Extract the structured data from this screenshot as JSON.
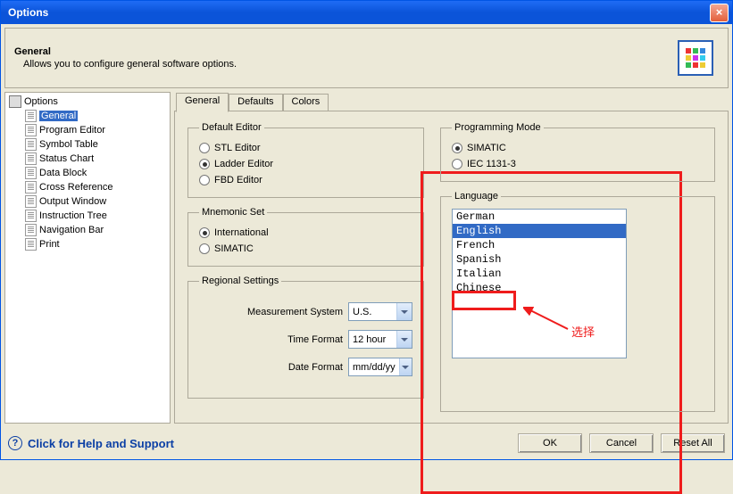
{
  "window": {
    "title": "Options"
  },
  "header": {
    "title": "General",
    "desc": "Allows you to configure general software options."
  },
  "tree": {
    "root": "Options",
    "items": [
      "General",
      "Program Editor",
      "Symbol Table",
      "Status Chart",
      "Data Block",
      "Cross Reference",
      "Output Window",
      "Instruction Tree",
      "Navigation Bar",
      "Print"
    ],
    "selected": 0
  },
  "tabs": {
    "items": [
      "General",
      "Defaults",
      "Colors"
    ],
    "active": 0
  },
  "default_editor": {
    "legend": "Default Editor",
    "options": [
      "STL Editor",
      "Ladder Editor",
      "FBD Editor"
    ],
    "selected": 1
  },
  "mnemonic_set": {
    "legend": "Mnemonic Set",
    "options": [
      "International",
      "SIMATIC"
    ],
    "selected": 0
  },
  "regional": {
    "legend": "Regional Settings",
    "measurement_label": "Measurement System",
    "measurement_value": "U.S.",
    "time_label": "Time Format",
    "time_value": "12 hour",
    "date_label": "Date Format",
    "date_value": "mm/dd/yy"
  },
  "programming_mode": {
    "legend": "Programming Mode",
    "options": [
      "SIMATIC",
      "IEC 1131-3"
    ],
    "selected": 0
  },
  "language": {
    "legend": "Language",
    "items": [
      "German",
      "English",
      "French",
      "Spanish",
      "Italian",
      "Chinese"
    ],
    "selected": 1
  },
  "annotation": {
    "text": "选择"
  },
  "footer": {
    "help": "Click for Help and Support",
    "ok": "OK",
    "cancel": "Cancel",
    "reset": "Reset All"
  }
}
